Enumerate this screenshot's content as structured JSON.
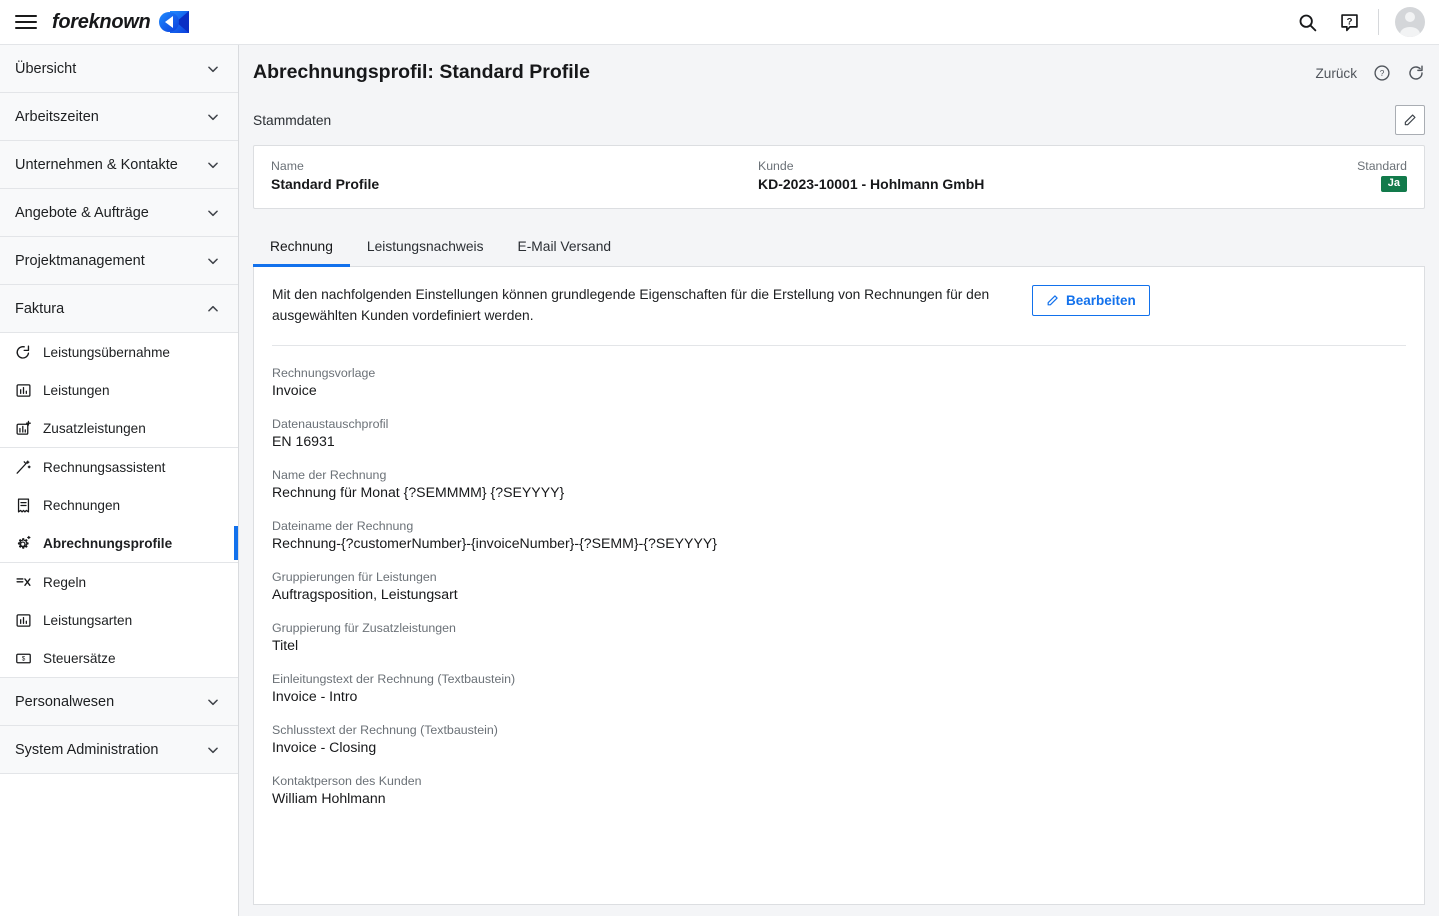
{
  "topbar": {
    "menu_icon": "hamburger-menu-icon",
    "brand": "foreknown",
    "search_icon": "search-icon",
    "help_icon": "help-question-icon",
    "avatar_icon": "user-avatar"
  },
  "sidebar": {
    "groups": [
      {
        "label": "Übersicht",
        "expanded": false,
        "items": []
      },
      {
        "label": "Arbeitszeiten",
        "expanded": false,
        "items": []
      },
      {
        "label": "Unternehmen & Kontakte",
        "expanded": false,
        "items": []
      },
      {
        "label": "Angebote & Aufträge",
        "expanded": false,
        "items": []
      },
      {
        "label": "Projektmanagement",
        "expanded": false,
        "items": []
      },
      {
        "label": "Faktura",
        "expanded": true,
        "items": []
      },
      {
        "label": "Personalwesen",
        "expanded": false,
        "items": []
      },
      {
        "label": "System Administration",
        "expanded": false,
        "items": []
      }
    ],
    "faktura_items": [
      {
        "label": "Leistungsübernahme",
        "icon": "import-arrow-icon",
        "active": false
      },
      {
        "label": "Leistungen",
        "icon": "bar-chart-icon",
        "active": false
      },
      {
        "label": "Zusatzleistungen",
        "icon": "bar-chart-plus-icon",
        "active": false
      },
      {
        "label": "Rechnungsassistent",
        "icon": "magic-wand-icon",
        "active": false
      },
      {
        "label": "Rechnungen",
        "icon": "receipt-icon",
        "active": false
      },
      {
        "label": "Abrechnungsprofile",
        "icon": "gear-plus-icon",
        "active": true
      },
      {
        "label": "Regeln",
        "icon": "rules-icon",
        "active": false
      },
      {
        "label": "Leistungsarten",
        "icon": "bar-chart-icon",
        "active": false
      },
      {
        "label": "Steuersätze",
        "icon": "money-bill-icon",
        "active": false
      }
    ]
  },
  "page": {
    "title": "Abrechnungsprofil: Standard Profile",
    "back_label": "Zurück",
    "help_icon": "help-circle-icon",
    "refresh_icon": "refresh-icon",
    "subheading": "Stammdaten",
    "edit_pencil_icon": "pencil-icon"
  },
  "summary": {
    "name_label": "Name",
    "name_value": "Standard Profile",
    "customer_label": "Kunde",
    "customer_value": "KD-2023-10001 - Hohlmann GmbH",
    "standard_label": "Standard",
    "standard_badge": "Ja"
  },
  "tabs": [
    {
      "label": "Rechnung",
      "active": true
    },
    {
      "label": "Leistungsnachweis",
      "active": false
    },
    {
      "label": "E-Mail Versand",
      "active": false
    }
  ],
  "panel": {
    "description": "Mit den nachfolgenden Einstellungen können grundlegende Eigenschaften für die Erstellung von Rechnungen für den ausgewählten Kunden vordefiniert werden.",
    "edit_button": "Bearbeiten",
    "edit_button_icon": "pencil-icon",
    "fields": [
      {
        "label": "Rechnungsvorlage",
        "value": "Invoice"
      },
      {
        "label": "Datenaustauschprofil",
        "value": "EN 16931"
      },
      {
        "label": "Name der Rechnung",
        "value": "Rechnung für Monat {?SEMMMM} {?SEYYYY}"
      },
      {
        "label": "Dateiname der Rechnung",
        "value": "Rechnung-{?customerNumber}-{invoiceNumber}-{?SEMM}-{?SEYYYY}"
      },
      {
        "label": "Gruppierungen für Leistungen",
        "value": "Auftragsposition, Leistungsart"
      },
      {
        "label": "Gruppierung für Zusatzleistungen",
        "value": "Titel"
      },
      {
        "label": "Einleitungstext der Rechnung (Textbaustein)",
        "value": "Invoice - Intro"
      },
      {
        "label": "Schlusstext der Rechnung (Textbaustein)",
        "value": "Invoice - Closing"
      },
      {
        "label": "Kontaktperson des Kunden",
        "value": "William Hohlmann"
      }
    ]
  },
  "colors": {
    "accent": "#1271ec",
    "badge_green": "#127a4b",
    "page_bg": "#f4f5f7",
    "label_gray": "#6b7177"
  }
}
